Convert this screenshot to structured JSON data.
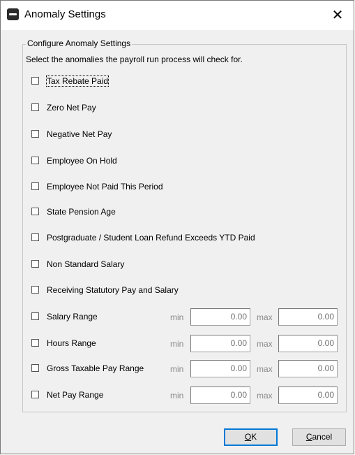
{
  "window": {
    "title": "Anomaly Settings",
    "close_glyph": "✕",
    "app_icon": "app-icon"
  },
  "group": {
    "label": "Configure Anomaly Settings",
    "hint": "Select the anomalies the payroll run process will check for."
  },
  "checks": [
    {
      "label": "Tax Rebate Paid",
      "checked": false
    },
    {
      "label": "Zero Net Pay",
      "checked": false
    },
    {
      "label": "Negative Net Pay",
      "checked": false
    },
    {
      "label": "Employee On Hold",
      "checked": false
    },
    {
      "label": "Employee Not Paid This Period",
      "checked": false
    },
    {
      "label": "State Pension Age",
      "checked": false
    },
    {
      "label": "Postgraduate / Student Loan Refund Exceeds YTD Paid",
      "checked": false
    },
    {
      "label": "Non Standard Salary",
      "checked": false
    },
    {
      "label": "Receiving Statutory Pay and Salary",
      "checked": false
    }
  ],
  "ranges": [
    {
      "label": "Salary Range",
      "min_label": "min",
      "min": "0.00",
      "max_label": "max",
      "max": "0.00",
      "checked": false
    },
    {
      "label": "Hours Range",
      "min_label": "min",
      "min": "0.00",
      "max_label": "max",
      "max": "0.00",
      "checked": false
    },
    {
      "label": "Gross Taxable Pay Range",
      "min_label": "min",
      "min": "0.00",
      "max_label": "max",
      "max": "0.00",
      "checked": false
    },
    {
      "label": "Net Pay Range",
      "min_label": "min",
      "min": "0.00",
      "max_label": "max",
      "max": "0.00",
      "checked": false
    }
  ],
  "buttons": {
    "ok": "OK",
    "ok_mnemonic": "O",
    "ok_rest": "K",
    "cancel": "Cancel",
    "cancel_mnemonic": "C",
    "cancel_rest": "ancel"
  },
  "colors": {
    "accent": "#0078d7",
    "disabled_text": "#8a8a8a"
  }
}
